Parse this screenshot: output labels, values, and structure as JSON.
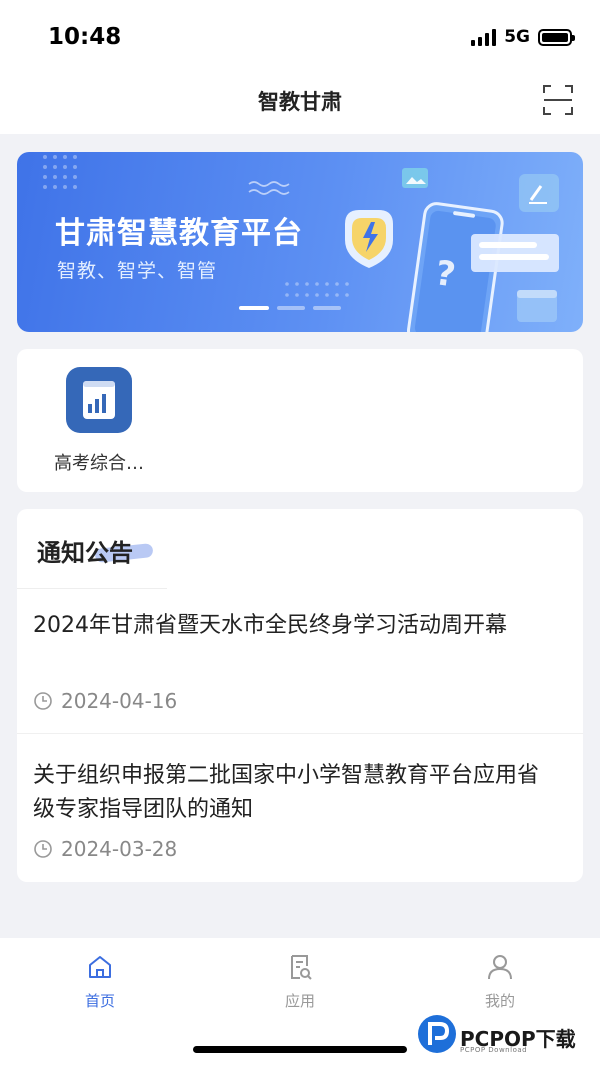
{
  "status_bar": {
    "time": "10:48",
    "network": "5G"
  },
  "nav": {
    "title": "智教甘肃",
    "scan_icon": "scan-icon"
  },
  "banner": {
    "title": "甘肃智慧教育平台",
    "subtitle": "智教、智学、智管",
    "slide_count": 3,
    "active_slide": 1
  },
  "apps": [
    {
      "label": "高考综合…",
      "icon": "bar-chart-book-icon"
    }
  ],
  "notices": {
    "title": "通知公告",
    "items": [
      {
        "text": "2024年甘肃省暨天水市全民终身学习活动周开幕",
        "date": "2024-04-16"
      },
      {
        "text": "关于组织申报第二批国家中小学智慧教育平台应用省级专家指导团队的通知",
        "date": "2024-03-28"
      }
    ]
  },
  "tabs": [
    {
      "label": "首页",
      "icon": "home-icon",
      "active": true
    },
    {
      "label": "应用",
      "icon": "document-search-icon",
      "active": false
    },
    {
      "label": "我的",
      "icon": "user-icon",
      "active": false
    }
  ],
  "watermark": {
    "brand": "PCPOP下载",
    "sub": "PCPOP Download"
  },
  "colors": {
    "accent": "#3c6ee0",
    "banner_start": "#3f73e8",
    "app_icon": "#3568b8",
    "background": "#f1f2f6"
  }
}
